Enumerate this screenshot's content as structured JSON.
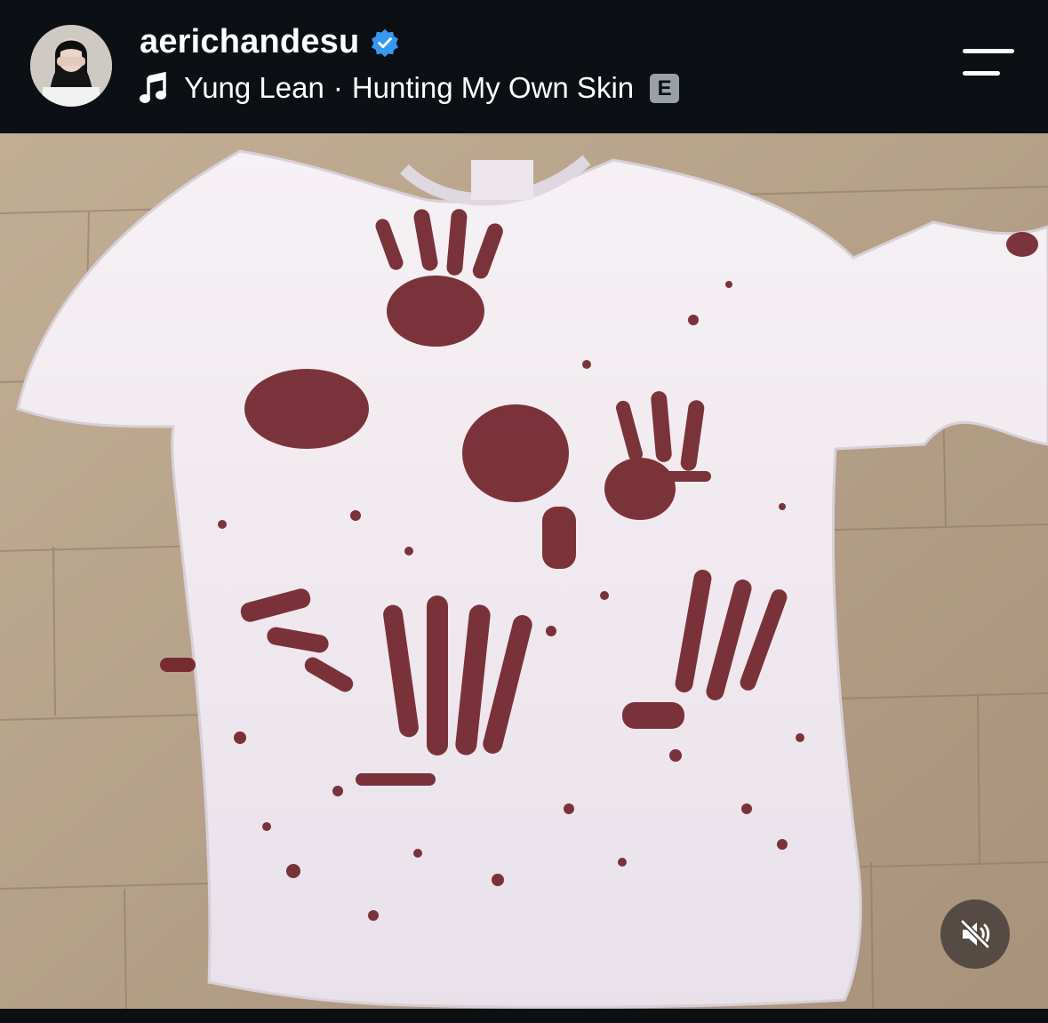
{
  "post": {
    "username": "aerichandesu",
    "verified": true,
    "audio": {
      "artist": "Yung Lean",
      "separator": "·",
      "track": "Hunting My Own Skin",
      "explicit_badge": "E"
    }
  },
  "icons": {
    "music": "music-note-icon",
    "verified": "verified-badge-icon",
    "menu": "hamburger-menu-icon",
    "mute": "speaker-muted-icon"
  },
  "colors": {
    "background": "#0c0f14",
    "verified_blue": "#3897f0",
    "stain": "#6b1a22",
    "floor": "#b9a58f",
    "shirt": "#f1eaf0"
  },
  "media": {
    "subject": "white t-shirt with red handprint stains on wooden floor"
  }
}
